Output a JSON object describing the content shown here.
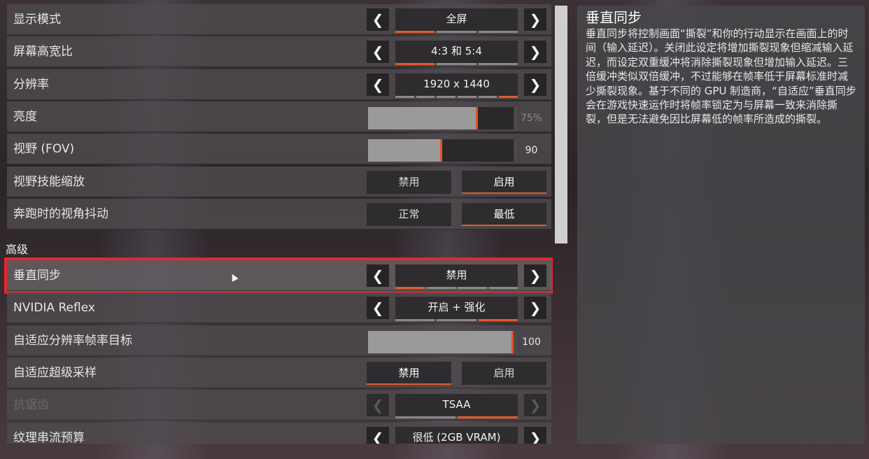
{
  "settings": {
    "rows": [
      {
        "label": "显示模式",
        "type": "selector",
        "value": "全屏",
        "segments": 3,
        "active_segment": 0
      },
      {
        "label": "屏幕高宽比",
        "type": "selector",
        "value": "4:3 和 5:4",
        "segments": 3,
        "active_segment": 0
      },
      {
        "label": "分辨率",
        "type": "selector",
        "value": "1920 x 1440",
        "segments": 6,
        "active_segment": 5
      },
      {
        "label": "亮度",
        "type": "slider",
        "value": "75%",
        "fill": 0.75
      },
      {
        "label": "视野 (FOV)",
        "type": "slider",
        "value": "90",
        "fill": 0.5
      },
      {
        "label": "视野技能缩放",
        "type": "toggle",
        "options": [
          "禁用",
          "启用"
        ],
        "active": 1
      },
      {
        "label": "奔跑时的视角抖动",
        "type": "toggle",
        "options": [
          "正常",
          "最低"
        ],
        "active": 1
      }
    ],
    "advanced_title": "高级",
    "advanced_rows": [
      {
        "label": "垂直同步",
        "type": "selector",
        "value": "禁用",
        "segments": 4,
        "active_segment": 0,
        "highlighted": true
      },
      {
        "label": "NVIDIA Reflex",
        "type": "selector",
        "value": "开启 + 强化",
        "segments": 3,
        "active_segment": 2
      },
      {
        "label": "自适应分辨率帧率目标",
        "type": "slider",
        "value": "100",
        "fill": 1.0
      },
      {
        "label": "自适应超级采样",
        "type": "toggle",
        "options": [
          "禁用",
          "启用"
        ],
        "active": 0
      },
      {
        "label": "抗锯齿",
        "type": "selector",
        "value": "TSAA",
        "segments": 2,
        "active_segment": 1,
        "disabled": true
      },
      {
        "label": "纹理串流预算",
        "type": "selector",
        "value": "很低 (2GB VRAM)",
        "segments": 0,
        "active_segment": -1
      }
    ]
  },
  "description": {
    "title": "垂直同步",
    "body": "垂直同步将控制画面“撕裂”和你的行动显示在画面上的时间（输入延迟）。关闭此设定将增加撕裂现象但缩减输入延迟，而设定双重缓冲将消除撕裂现象但增加输入延迟。三倍缓冲类似双倍缓冲，不过能够在帧率低于屏幕标准时减少撕裂现象。基于不同的 GPU 制造商，“自适应”垂直同步会在游戏快速运作时将帧率锁定为与屏幕一致来消除撕裂，但是无法避免因比屏幕低的帧率所造成的撕裂。"
  },
  "icons": {
    "left_arrow": "chevron-left-icon",
    "right_arrow": "chevron-right-icon"
  },
  "colors": {
    "accent": "#e45a2a",
    "highlight_border": "#e8262c"
  }
}
